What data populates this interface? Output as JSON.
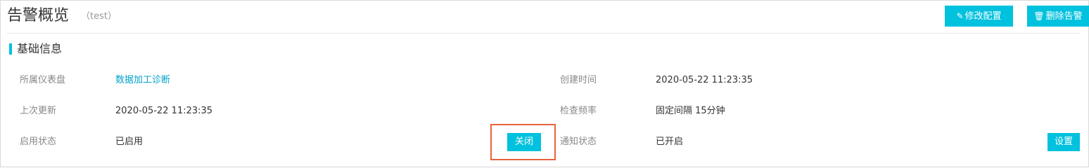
{
  "header": {
    "title": "告警概览",
    "subtitle": "（test）",
    "edit_button": {
      "icon": "edit-icon",
      "label": "修改配置"
    },
    "delete_button": {
      "icon": "trash-icon",
      "label": "删除告警"
    }
  },
  "section": {
    "title": "基础信息"
  },
  "fields": {
    "dashboard": {
      "label": "所属仪表盘",
      "value": "数据加工诊断"
    },
    "created": {
      "label": "创建时间",
      "value": "2020-05-22 11:23:35"
    },
    "updated": {
      "label": "上次更新",
      "value": "2020-05-22 11:23:35"
    },
    "frequency": {
      "label": "检查频率",
      "value": "固定间隔 15分钟"
    },
    "enabled": {
      "label": "启用状态",
      "value": "已启用",
      "action": "关闭"
    },
    "notify": {
      "label": "通知状态",
      "value": "已开启",
      "action": "设置"
    }
  },
  "colors": {
    "accent": "#00c1de",
    "link": "#00a2ca",
    "highlight": "#e8623d"
  }
}
